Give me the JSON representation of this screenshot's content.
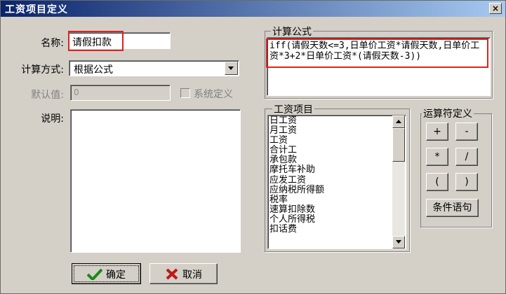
{
  "window": {
    "title": "工资项目定义",
    "close_label": "×"
  },
  "form": {
    "name_label": "名称:",
    "name_value": "请假扣款",
    "calc_label": "计算方式:",
    "calc_value": "根据公式",
    "default_label": "默认值:",
    "default_value": "0",
    "system_label": "系统定义",
    "desc_label": "说明:"
  },
  "formula": {
    "group_label": "计算公式",
    "text": "iff(请假天数<=3,日单价工资*请假天数,日单价工资*3+2*日单价工资*(请假天数-3))"
  },
  "salary_items": {
    "group_label": "工资项目",
    "items": [
      "日工资",
      "月工资",
      "工资",
      "合计工",
      "承包款",
      "摩托车补助",
      "应发工资",
      "应纳税所得额",
      "税率",
      "速算扣除数",
      "个人所得税",
      "扣话费"
    ]
  },
  "operators": {
    "group_label": "运算符定义",
    "plus": "+",
    "minus": "-",
    "multiply": "*",
    "divide": "/",
    "lparen": "(",
    "rparen": ")",
    "condition": "条件语句"
  },
  "buttons": {
    "ok": "确定",
    "cancel": "取消"
  },
  "colors": {
    "highlight": "#e02020",
    "title_start": "#0a246a",
    "title_end": "#a6caf0"
  }
}
